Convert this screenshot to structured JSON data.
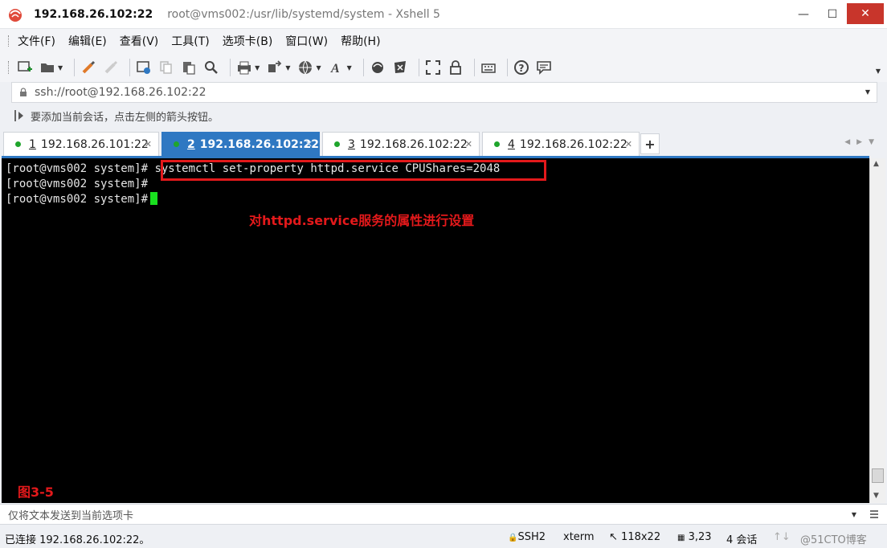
{
  "window": {
    "title_main": "192.168.26.102:22",
    "title_sub": "root@vms002:/usr/lib/systemd/system - Xshell 5",
    "minimize": "—",
    "maximize": "☐",
    "close": "✕"
  },
  "menu": [
    "文件(F)",
    "编辑(E)",
    "查看(V)",
    "工具(T)",
    "选项卡(B)",
    "窗口(W)",
    "帮助(H)"
  ],
  "address": {
    "value": "ssh://root@192.168.26.102:22"
  },
  "hint": {
    "text": "要添加当前会话，点击左侧的箭头按钮。"
  },
  "tabs": [
    {
      "num": "1",
      "host": "192.168.26.101:22",
      "active": false,
      "status_color": "#1fa52c"
    },
    {
      "num": "2",
      "host": "192.168.26.102:22",
      "active": true,
      "status_color": "#1fa52c"
    },
    {
      "num": "3",
      "host": "192.168.26.102:22",
      "active": false,
      "status_color": "#1fa52c"
    },
    {
      "num": "4",
      "host": "192.168.26.102:22",
      "active": false,
      "status_color": "#1fa52c"
    }
  ],
  "tab_add": "+",
  "terminal": {
    "prompt": "[root@vms002 system]#",
    "command": "systemctl set-property httpd.service CPUShares=2048",
    "annotation": "对httpd.service服务的属性进行设置",
    "figure_label": "图3-5",
    "highlight_color": "#e3191b",
    "cursor_color": "#19e01f"
  },
  "send_bar": {
    "placeholder": "仅将文本发送到当前选项卡"
  },
  "status": {
    "connection": "已连接 192.168.26.102:22。",
    "protocol": "SSH2",
    "term_type": "xterm",
    "size": "118x22",
    "cursor_pos": "3,23",
    "sessions": "4 会话",
    "watermark": "@51CTO博客"
  },
  "colors": {
    "accent": "#2f78c2",
    "close_button": "#c8352b"
  }
}
